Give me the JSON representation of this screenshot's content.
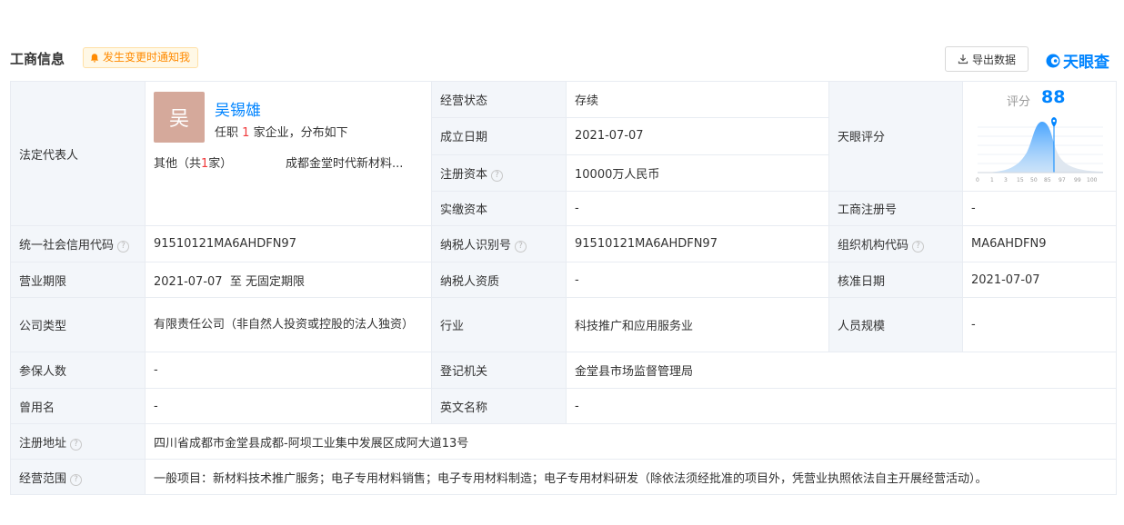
{
  "header": {
    "title": "工商信息",
    "notify_label": "发生变更时通知我",
    "export_label": "导出数据",
    "brand": "天眼查"
  },
  "rep": {
    "label": "法定代表人",
    "avatar_char": "吴",
    "name": "吴锡雄",
    "role_prefix": "任职",
    "count": "1",
    "role_suffix": "家企业，分布如下",
    "other_prefix": "其他（共",
    "other_count": "1",
    "other_suffix": "家）",
    "company": "成都金堂时代新材料..."
  },
  "fields": {
    "status_label": "经营状态",
    "status_value": "存续",
    "founded_label": "成立日期",
    "founded_value": "2021-07-07",
    "capital_label": "注册资本",
    "capital_value": "10000万人民币",
    "paidin_label": "实缴资本",
    "paidin_value": "-",
    "score_label": "天眼评分",
    "regno_label": "工商注册号",
    "regno_value": "-",
    "credit_label": "统一社会信用代码",
    "credit_value": "91510121MA6AHDFN97",
    "taxid_label": "纳税人识别号",
    "taxid_value": "91510121MA6AHDFN97",
    "orgcode_label": "组织机构代码",
    "orgcode_value": "MA6AHDFN9",
    "term_label": "营业期限",
    "term_value": "2021-07-07  至 无固定期限",
    "taxqual_label": "纳税人资质",
    "taxqual_value": "-",
    "approve_label": "核准日期",
    "approve_value": "2021-07-07",
    "type_label": "公司类型",
    "type_value": "有限责任公司（非自然人投资或控股的法人独资）",
    "industry_label": "行业",
    "industry_value": "科技推广和应用服务业",
    "staff_label": "人员规模",
    "staff_value": "-",
    "insured_label": "参保人数",
    "insured_value": "-",
    "authority_label": "登记机关",
    "authority_value": "金堂县市场监督管理局",
    "formername_label": "曾用名",
    "formername_value": "-",
    "english_label": "英文名称",
    "english_value": "-",
    "address_label": "注册地址",
    "address_value": "四川省成都市金堂县成都-阿坝工业集中发展区成阿大道13号",
    "scope_label": "经营范围",
    "scope_value": "一般项目：新材料技术推广服务；电子专用材料销售；电子专用材料制造；电子专用材料研发（除依法须经批准的项目外，凭营业执照依法自主开展经营活动）。"
  },
  "score": {
    "label": "评分",
    "value": "88",
    "ticks": [
      "0",
      "1",
      "3",
      "15",
      "50",
      "85",
      "97",
      "99",
      "100"
    ],
    "accent": "#0084ff"
  }
}
